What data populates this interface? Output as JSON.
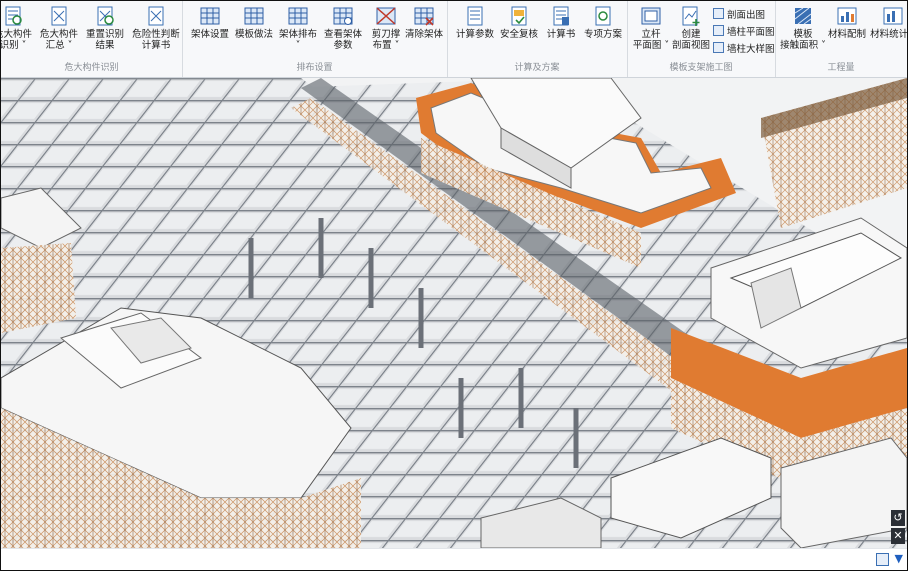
{
  "ribbon": {
    "groups": [
      {
        "label": "危大构件识别",
        "buttons": [
          "危大构件\n识别 ˅",
          "危大构件\n汇总 ˅",
          "重置识别\n结果",
          "危险性判断\n计算书"
        ]
      },
      {
        "label": "排布设置",
        "buttons": [
          "架体设置",
          "模板做法",
          "架体排布\n˅",
          "查看架体\n参数",
          "剪刀撑\n布置 ˅",
          "清除架体"
        ]
      },
      {
        "label": "计算及方案",
        "buttons": [
          "计算参数",
          "安全复核",
          "计算书",
          "专项方案"
        ]
      },
      {
        "label": "模板支架施工图",
        "buttons": [
          "立杆\n平面图 ˅",
          "创建\n剖面视图"
        ],
        "small_buttons": [
          "剖面出图",
          "墙柱平面图",
          "墙柱大样图"
        ]
      },
      {
        "label": "工程量",
        "buttons": [
          "模板\n接触面积 ˅",
          "材料配制",
          "材料统计 ˅"
        ]
      }
    ]
  },
  "viewport": {
    "description_icons": [
      "undo-icon",
      "close-icon"
    ]
  },
  "colors": {
    "accent": "#e07b31",
    "grid": "#c9ccd1",
    "beam": "#6b7078",
    "ribbon_bg": "#f7f8fa",
    "scaffold": "#c98a55"
  }
}
